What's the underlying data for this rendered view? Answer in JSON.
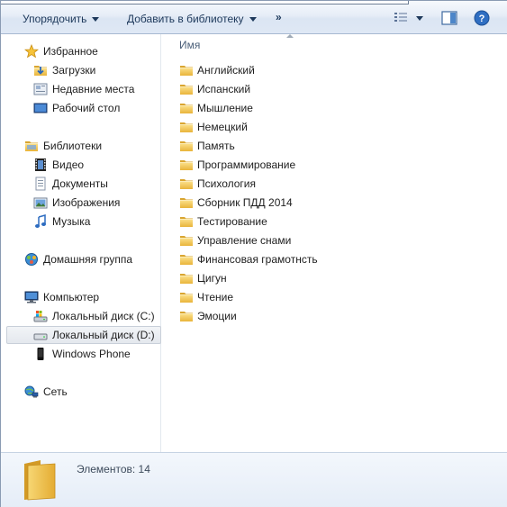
{
  "toolbar": {
    "organize_label": "Упорядочить",
    "add_to_library_label": "Добавить в библиотеку",
    "more_label": "»",
    "view_icon": "view-options-icon",
    "preview_pane_icon": "preview-pane-icon",
    "help_icon": "help-icon"
  },
  "nav": {
    "favorites": {
      "label": "Избранное",
      "items": [
        {
          "label": "Загрузки",
          "icon": "downloads-icon"
        },
        {
          "label": "Недавние места",
          "icon": "recent-places-icon"
        },
        {
          "label": "Рабочий стол",
          "icon": "desktop-icon"
        }
      ]
    },
    "libraries": {
      "label": "Библиотеки",
      "items": [
        {
          "label": "Видео",
          "icon": "video-icon"
        },
        {
          "label": "Документы",
          "icon": "documents-icon"
        },
        {
          "label": "Изображения",
          "icon": "pictures-icon"
        },
        {
          "label": "Музыка",
          "icon": "music-icon"
        }
      ]
    },
    "homegroup": {
      "label": "Домашняя группа"
    },
    "computer": {
      "label": "Компьютер",
      "items": [
        {
          "label": "Локальный диск (C:)",
          "icon": "system-drive-icon"
        },
        {
          "label": "Локальный диск (D:)",
          "icon": "drive-icon",
          "selected": true
        },
        {
          "label": "Windows Phone",
          "icon": "phone-icon"
        }
      ]
    },
    "network": {
      "label": "Сеть"
    }
  },
  "content": {
    "column_header": "Имя",
    "folders": [
      "Английский",
      "Испанский",
      "Мышление",
      "Немецкий",
      "Память",
      "Программирование",
      "Психология",
      "Сборник ПДД 2014",
      "Тестирование",
      "Управление снами",
      "Финансовая грамотнсть",
      "Цигун",
      "Чтение",
      "Эмоции"
    ]
  },
  "details": {
    "count_text": "Элементов: 14"
  },
  "colors": {
    "toolbar_text": "#1e395b",
    "folder_yellow": "#f1c24a"
  }
}
